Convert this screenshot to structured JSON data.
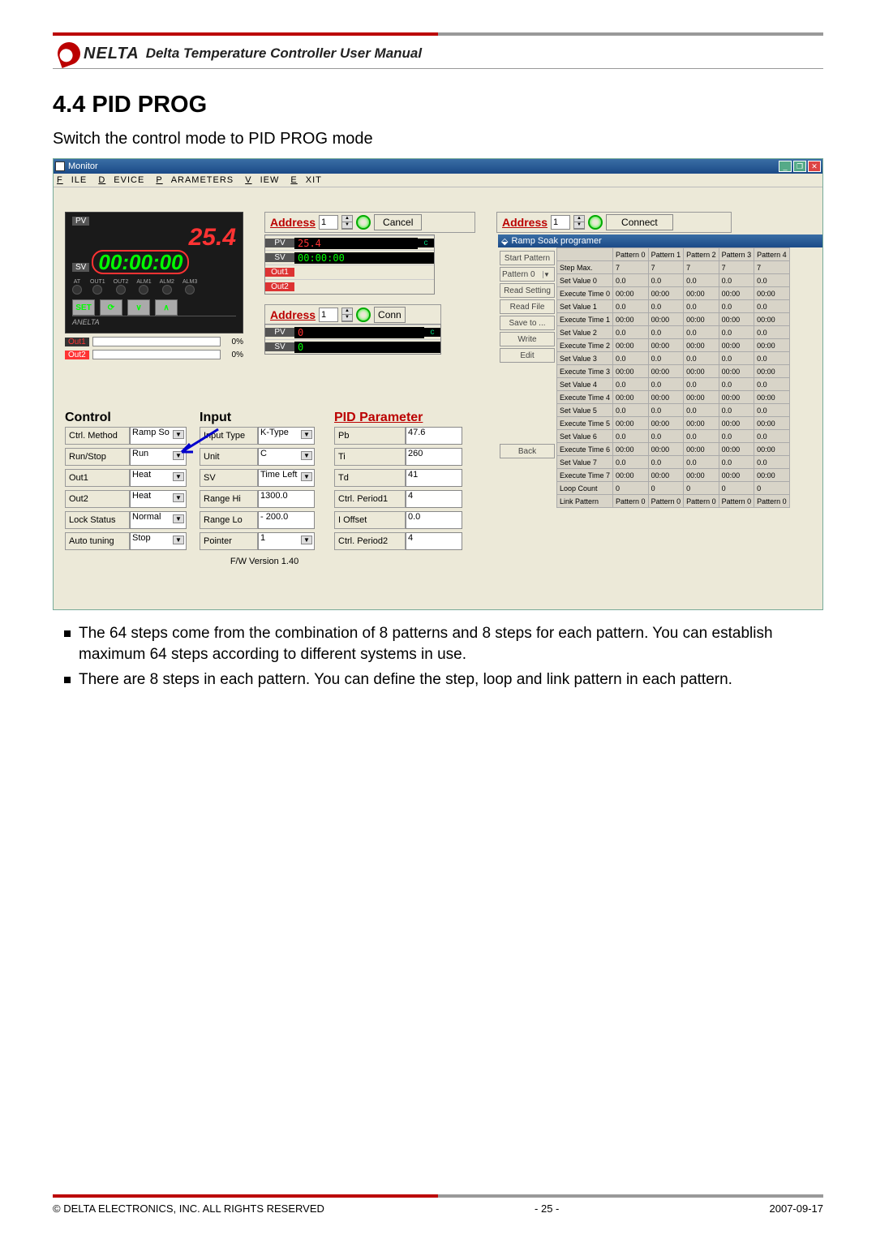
{
  "header": {
    "brand": "NELTA",
    "manual": "Delta Temperature Controller User Manual"
  },
  "section": {
    "num_title": "4.4 PID PROG",
    "subtitle": "Switch the control mode to PID PROG mode"
  },
  "window": {
    "title": "Monitor",
    "menus": [
      "FILE",
      "DEVICE",
      "PARAMETERS",
      "VIEW",
      "EXIT"
    ],
    "addr1": {
      "label": "Address",
      "value": "1",
      "btn": "Cancel"
    },
    "addr2": {
      "label": "Address",
      "value": "1",
      "btn": "Connect"
    },
    "addr3": {
      "label": "Address",
      "value": "1",
      "btn": "Conn"
    },
    "pvpanel": {
      "pv_label": "PV",
      "pv_value": "25.4",
      "sv_label": "SV",
      "sv_value": "00:00:00",
      "leds": [
        "AT",
        "OUT1",
        "OUT2",
        "ALM1",
        "ALM2",
        "ALM3"
      ],
      "keys": [
        "SET",
        "⟳",
        "∨",
        "∧"
      ],
      "brand_foot": "ANELTA",
      "out1_label": "Out1",
      "out1_pct": "0%",
      "out2_label": "Out2",
      "out2_pct": "0%"
    },
    "mini1": {
      "pv": "25.4",
      "sv": "00:00:00",
      "o1": "Out1",
      "o2": "Out2",
      "c": "c"
    },
    "mini2": {
      "pv": "0",
      "sv": "0",
      "c": "c"
    },
    "control_title": "Control",
    "control_rows": [
      {
        "l": "Ctrl. Method",
        "v": "Ramp So",
        "dd": true
      },
      {
        "l": "Run/Stop",
        "v": "Run",
        "dd": true
      },
      {
        "l": "Out1",
        "v": "Heat",
        "dd": true
      },
      {
        "l": "Out2",
        "v": "Heat",
        "dd": true
      },
      {
        "l": "Lock Status",
        "v": "Normal",
        "dd": true
      },
      {
        "l": "Auto tuning",
        "v": "Stop",
        "dd": true
      }
    ],
    "input_title": "Input",
    "input_rows": [
      {
        "l": "Input Type",
        "v": "K-Type",
        "dd": true
      },
      {
        "l": "Unit",
        "v": "C",
        "dd": true
      },
      {
        "l": "SV",
        "v": "Time Left",
        "dd": true
      },
      {
        "l": "Range Hi",
        "v": "1300.0"
      },
      {
        "l": "Range Lo",
        "v": "- 200.0"
      },
      {
        "l": "Pointer",
        "v": "1",
        "dd": true
      }
    ],
    "pid_title": "PID Parameter",
    "pid_rows": [
      {
        "l": "Pb",
        "v": "47.6"
      },
      {
        "l": "Ti",
        "v": "260"
      },
      {
        "l": "Td",
        "v": "41"
      },
      {
        "l": "Ctrl. Period1",
        "v": "4"
      },
      {
        "l": "I Offset",
        "v": "0.0"
      },
      {
        "l": "Ctrl. Period2",
        "v": "4"
      }
    ],
    "fw": "F/W Version 1.40",
    "ramp": {
      "title": "Ramp Soak programer",
      "left_buttons": [
        "Start Pattern",
        "Pattern 0",
        "Read Setting",
        "Read File",
        "Save to ...",
        "Write",
        "Edit",
        "",
        "",
        "",
        "",
        "Back"
      ],
      "columns": [
        "",
        "Pattern 0",
        "Pattern 1",
        "Pattern 2",
        "Pattern 3",
        "Pattern 4"
      ],
      "rows": [
        [
          "Step Max.",
          "7",
          "7",
          "7",
          "7",
          "7"
        ],
        [
          "Set Value 0",
          "0.0",
          "0.0",
          "0.0",
          "0.0",
          "0.0"
        ],
        [
          "Execute Time 0",
          "00:00",
          "00:00",
          "00:00",
          "00:00",
          "00:00"
        ],
        [
          "Set Value 1",
          "0.0",
          "0.0",
          "0.0",
          "0.0",
          "0.0"
        ],
        [
          "Execute Time 1",
          "00:00",
          "00:00",
          "00:00",
          "00:00",
          "00:00"
        ],
        [
          "Set Value 2",
          "0.0",
          "0.0",
          "0.0",
          "0.0",
          "0.0"
        ],
        [
          "Execute Time 2",
          "00:00",
          "00:00",
          "00:00",
          "00:00",
          "00:00"
        ],
        [
          "Set Value 3",
          "0.0",
          "0.0",
          "0.0",
          "0.0",
          "0.0"
        ],
        [
          "Execute Time 3",
          "00:00",
          "00:00",
          "00:00",
          "00:00",
          "00:00"
        ],
        [
          "Set Value 4",
          "0.0",
          "0.0",
          "0.0",
          "0.0",
          "0.0"
        ],
        [
          "Execute Time 4",
          "00:00",
          "00:00",
          "00:00",
          "00:00",
          "00:00"
        ],
        [
          "Set Value 5",
          "0.0",
          "0.0",
          "0.0",
          "0.0",
          "0.0"
        ],
        [
          "Execute Time 5",
          "00:00",
          "00:00",
          "00:00",
          "00:00",
          "00:00"
        ],
        [
          "Set Value 6",
          "0.0",
          "0.0",
          "0.0",
          "0.0",
          "0.0"
        ],
        [
          "Execute Time 6",
          "00:00",
          "00:00",
          "00:00",
          "00:00",
          "00:00"
        ],
        [
          "Set Value 7",
          "0.0",
          "0.0",
          "0.0",
          "0.0",
          "0.0"
        ],
        [
          "Execute Time 7",
          "00:00",
          "00:00",
          "00:00",
          "00:00",
          "00:00"
        ],
        [
          "Loop Count",
          "0",
          "0",
          "0",
          "0",
          "0"
        ],
        [
          "Link Pattern",
          "Pattern 0",
          "Pattern 0",
          "Pattern 0",
          "Pattern 0",
          "Pattern 0"
        ]
      ]
    }
  },
  "bullets": [
    "The 64 steps come from the combination of 8 patterns and 8 steps for each pattern. You can establish maximum 64 steps according to different systems in use.",
    "There are 8 steps in each pattern. You can define the step, loop and link pattern in each pattern."
  ],
  "footer": {
    "left": "© DELTA ELECTRONICS, INC. ALL RIGHTS RESERVED",
    "center": "- 25 -",
    "right": "2007-09-17"
  }
}
